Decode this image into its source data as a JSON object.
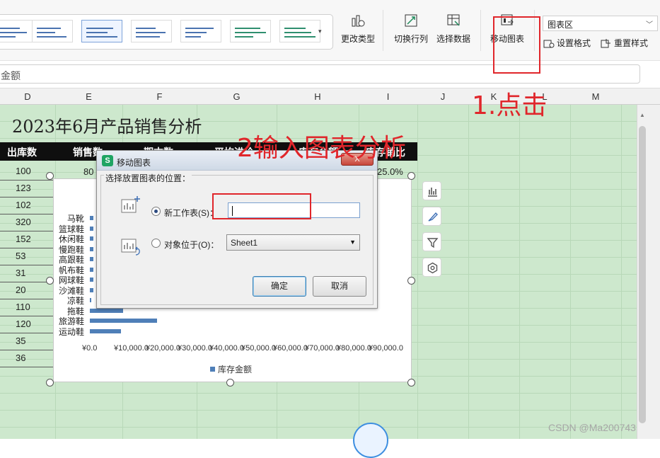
{
  "ribbon": {
    "change_type": "更改类型",
    "switch_row_col": "切换行列",
    "select_data": "选择数据",
    "move_chart": "移动图表",
    "chart_area_select": "图表区",
    "set_format": "设置格式",
    "reset_style": "重置样式"
  },
  "formula_bar": {
    "value": "金额"
  },
  "columns": [
    "D",
    "E",
    "F",
    "G",
    "H",
    "I",
    "J",
    "K",
    "L",
    "M"
  ],
  "sheet": {
    "title": "2023年6月产品销售分析",
    "headers": [
      "出库数",
      "销售数",
      "期末数",
      "平均进价",
      "库存金额",
      "库存销比"
    ],
    "row1_extra": {
      "sales": "80",
      "ratio": "25.0%"
    },
    "d_values": [
      "100",
      "123",
      "102",
      "320",
      "152",
      "53",
      "31",
      "20",
      "110",
      "120",
      "35",
      "36"
    ]
  },
  "chart_data": {
    "type": "bar",
    "orientation": "horizontal",
    "categories": [
      "马靴",
      "篮球鞋",
      "休闲鞋",
      "慢跑鞋",
      "高跟鞋",
      "帆布鞋",
      "网球鞋",
      "沙滩鞋",
      "凉鞋",
      "拖鞋",
      "旅游鞋",
      "运动鞋"
    ],
    "series": [
      {
        "name": "库存金额",
        "values": [
          1000,
          1000,
          1000,
          1000,
          1000,
          1000,
          1000,
          1000,
          500,
          10500,
          21000,
          9800
        ]
      }
    ],
    "x_ticks": [
      "¥0.0",
      "¥10,000.0",
      "¥20,000.0",
      "¥30,000.0",
      "¥40,000.0",
      "¥50,000.0",
      "¥60,000.0",
      "¥70,000.0",
      "¥80,000.0",
      "¥90,000.0"
    ],
    "xlim": [
      0,
      90000
    ],
    "legend": "bottom",
    "bar_color": "#4f7fb8"
  },
  "dialog": {
    "title": "移动图表",
    "close": "X",
    "group_label": "选择放置图表的位置：",
    "new_sheet_label": "新工作表(S)：",
    "new_sheet_value": "",
    "object_in_label": "对象位于(O)：",
    "object_in_value": "Sheet1",
    "ok": "确定",
    "cancel": "取消",
    "selected_option": "new_sheet"
  },
  "annotations": {
    "step1": "1.点击",
    "step2": "2输入图表分析",
    "color": "#e0262b"
  },
  "watermark": "CSDN @Ma200743"
}
